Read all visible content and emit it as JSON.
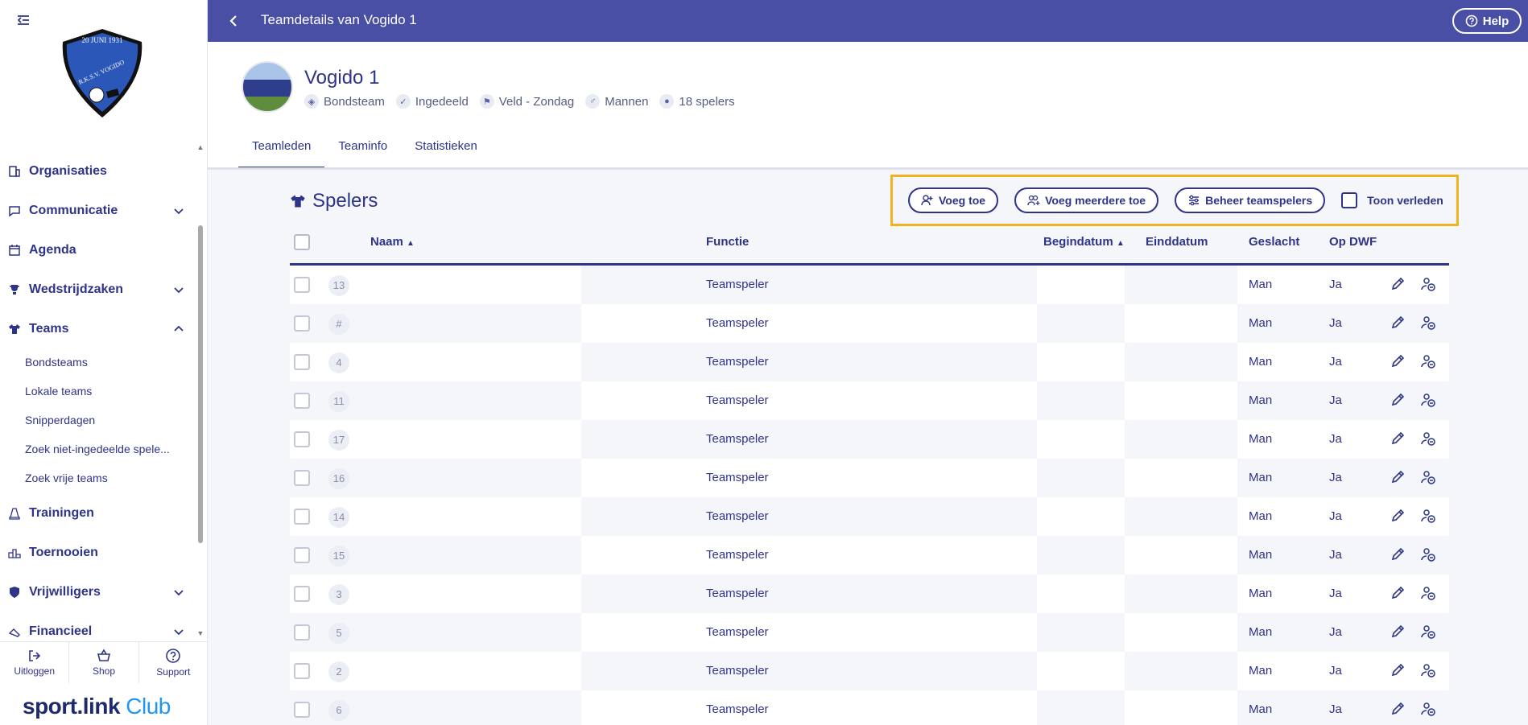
{
  "sidebar": {
    "logo": {
      "date_text": "20 JUNI 1931",
      "name_text": "R.K.S.V. VOGIDO"
    },
    "nav": [
      {
        "label": "Organisaties",
        "icon": "building-icon",
        "expandable": false
      },
      {
        "label": "Communicatie",
        "icon": "chat-icon",
        "expandable": true
      },
      {
        "label": "Agenda",
        "icon": "calendar-icon",
        "expandable": false
      },
      {
        "label": "Wedstrijdzaken",
        "icon": "trophy-icon",
        "expandable": true
      },
      {
        "label": "Teams",
        "icon": "shirt-icon",
        "expandable": true,
        "expanded": true
      },
      {
        "label": "Trainingen",
        "icon": "cone-icon",
        "expandable": false
      },
      {
        "label": "Toernooien",
        "icon": "podium-icon",
        "expandable": false
      },
      {
        "label": "Vrijwilligers",
        "icon": "heart-shield-icon",
        "expandable": true
      },
      {
        "label": "Financieel",
        "icon": "money-icon",
        "expandable": true
      }
    ],
    "sub_items": [
      "Bondsteams",
      "Lokale teams",
      "Snipperdagen",
      "Zoek niet-ingedeelde spele...",
      "Zoek vrije teams"
    ],
    "bottom": [
      {
        "label": "Uitloggen",
        "icon": "logout-icon"
      },
      {
        "label": "Shop",
        "icon": "basket-icon"
      },
      {
        "label": "Support",
        "icon": "help-circle-icon"
      }
    ],
    "brand": {
      "sport": "sport.",
      "link": "link",
      "club": " Club"
    }
  },
  "topbar": {
    "title": "Teamdetails van Vogido 1",
    "help_label": "Help"
  },
  "team": {
    "name": "Vogido 1",
    "meta": [
      {
        "label": "Bondsteam",
        "icon": "shield-icon"
      },
      {
        "label": "Ingedeeld",
        "icon": "check-icon"
      },
      {
        "label": "Veld - Zondag",
        "icon": "runner-icon"
      },
      {
        "label": "Mannen",
        "icon": "male-icon"
      },
      {
        "label": "18 spelers",
        "icon": "players-icon"
      }
    ]
  },
  "tabs": [
    {
      "label": "Teamleden",
      "active": true
    },
    {
      "label": "Teaminfo",
      "active": false
    },
    {
      "label": "Statistieken",
      "active": false
    }
  ],
  "section": {
    "title": "Spelers"
  },
  "actions": {
    "add": "Voeg toe",
    "add_multiple": "Voeg meerdere toe",
    "manage": "Beheer teamspelers",
    "show_past": "Toon verleden"
  },
  "table": {
    "columns": {
      "name": "Naam",
      "function": "Functie",
      "start": "Begindatum",
      "end": "Einddatum",
      "gender": "Geslacht",
      "dwf": "Op DWF"
    },
    "rows": [
      {
        "number": "13",
        "function": "Teamspeler",
        "gender": "Man",
        "dwf": "Ja"
      },
      {
        "number": "#",
        "function": "Teamspeler",
        "gender": "Man",
        "dwf": "Ja"
      },
      {
        "number": "4",
        "function": "Teamspeler",
        "gender": "Man",
        "dwf": "Ja"
      },
      {
        "number": "11",
        "function": "Teamspeler",
        "gender": "Man",
        "dwf": "Ja"
      },
      {
        "number": "17",
        "function": "Teamspeler",
        "gender": "Man",
        "dwf": "Ja"
      },
      {
        "number": "16",
        "function": "Teamspeler",
        "gender": "Man",
        "dwf": "Ja"
      },
      {
        "number": "14",
        "function": "Teamspeler",
        "gender": "Man",
        "dwf": "Ja"
      },
      {
        "number": "15",
        "function": "Teamspeler",
        "gender": "Man",
        "dwf": "Ja"
      },
      {
        "number": "3",
        "function": "Teamspeler",
        "gender": "Man",
        "dwf": "Ja"
      },
      {
        "number": "5",
        "function": "Teamspeler",
        "gender": "Man",
        "dwf": "Ja"
      },
      {
        "number": "2",
        "function": "Teamspeler",
        "gender": "Man",
        "dwf": "Ja"
      },
      {
        "number": "6",
        "function": "Teamspeler",
        "gender": "Man",
        "dwf": "Ja"
      }
    ]
  },
  "colors": {
    "primary": "#2e3487",
    "topbar": "#4a4fa6",
    "highlight": "#f3b21f",
    "brand_blue": "#2196f3"
  }
}
